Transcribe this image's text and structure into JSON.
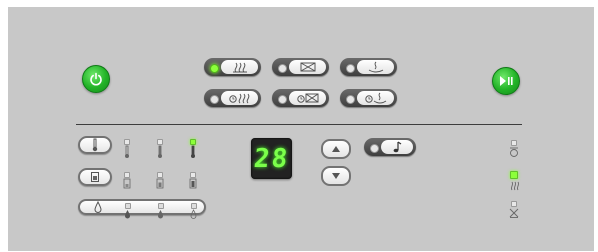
{
  "panel": {
    "background": "#c8c8c8",
    "accent_green": "#22b327",
    "display_green": "#7bff4a"
  },
  "power_button": {
    "icon": "power-icon"
  },
  "start_pause_button": {
    "icon": "play-pause-icon"
  },
  "program_buttons": [
    {
      "name": "steam-wash",
      "icon": "steam-lines-icon",
      "led_on": true
    },
    {
      "name": "lower-rack",
      "icon": "rack-icon",
      "led_on": false
    },
    {
      "name": "pot-wash",
      "icon": "pot-icon",
      "led_on": false
    },
    {
      "name": "steam-wash-eco",
      "icon": "eco-steam-icon",
      "led_on": false
    },
    {
      "name": "lower-rack-eco",
      "icon": "eco-rack-icon",
      "led_on": false
    },
    {
      "name": "pot-wash-eco",
      "icon": "eco-pot-icon",
      "led_on": false
    }
  ],
  "temperature": {
    "icon": "thermometer-icon",
    "levels": 3,
    "active_level": 3
  },
  "detergent": {
    "icon": "detergent-icon",
    "levels": 3,
    "active_level": 0
  },
  "rinse": {
    "icon": "droplet-icon",
    "levels": 3,
    "active_level": 0
  },
  "display": {
    "value": "28"
  },
  "up_button": {
    "icon": "triangle-up-icon"
  },
  "down_button": {
    "icon": "triangle-down-icon"
  },
  "sound_button": {
    "icon": "music-note-icon",
    "led_on": false
  },
  "status_indicators": [
    {
      "name": "rinse-aid-indicator",
      "icon": "rinse-aid-icon",
      "on": false
    },
    {
      "name": "salt-indicator",
      "icon": "salt-icon",
      "on": true
    },
    {
      "name": "filter-indicator",
      "icon": "filter-icon",
      "on": false
    }
  ]
}
